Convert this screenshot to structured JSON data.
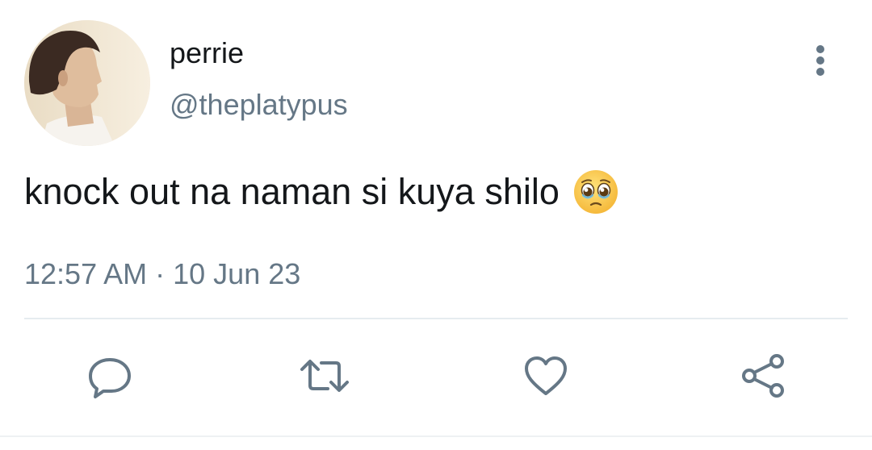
{
  "tweet": {
    "display_name": "perrie",
    "handle": "@theplatypus",
    "text": "knock out na naman si kuya shilo",
    "emoji": "pleading-face",
    "time": "12:57 AM",
    "separator": "·",
    "date": "10 Jun 23"
  },
  "icons": {
    "more": "vertical-dots-icon",
    "reply": "reply-icon",
    "retweet": "retweet-icon",
    "like": "heart-icon",
    "share": "share-icon"
  },
  "colors": {
    "text_primary": "#14171a",
    "text_secondary": "#657786",
    "divider": "#e6ecf0"
  }
}
